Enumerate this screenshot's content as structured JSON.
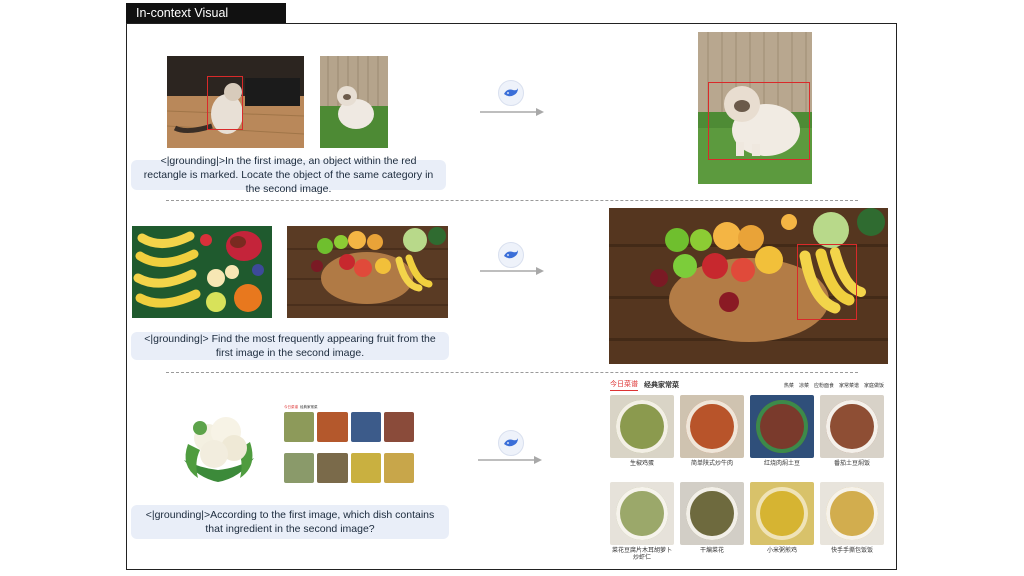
{
  "section_title": "In-context Visual Grounding",
  "rows": [
    {
      "prompt": "<|grounding|>In the first image, an object within the red rectangle is marked. Locate the object of the same category in the second image."
    },
    {
      "prompt": "<|grounding|> Find the most frequently appearing fruit from the first image in the second image."
    },
    {
      "prompt": "<|grounding|>According to the first image, which dish contains that ingredient in the second image?"
    }
  ],
  "recipe_site": {
    "tabs": [
      "今日菜谱",
      "经典家常菜"
    ],
    "nav": [
      "热菜",
      "凉菜",
      "应粉面食",
      "家常菜谱",
      "家庭做饭"
    ],
    "dishes": [
      {
        "name": "生椒鸡蛋",
        "sub": ""
      },
      {
        "name": "简单陕式炒牛肉",
        "sub": ""
      },
      {
        "name": "红烧肉焖土豆",
        "sub": ""
      },
      {
        "name": "番茄土豆焖饭",
        "sub": ""
      },
      {
        "name": "菜花豆腐片木耳胡萝卜炒虾仁",
        "sub": ""
      },
      {
        "name": "干煸菜花",
        "sub": ""
      },
      {
        "name": "小米粥煎鸡",
        "sub": ""
      },
      {
        "name": "快手手撕包饭饭",
        "sub": ""
      }
    ]
  },
  "colors": {
    "box": "#d92a2a",
    "prompt_bg": "#e9eef8",
    "logo": "#3b6fd8"
  }
}
